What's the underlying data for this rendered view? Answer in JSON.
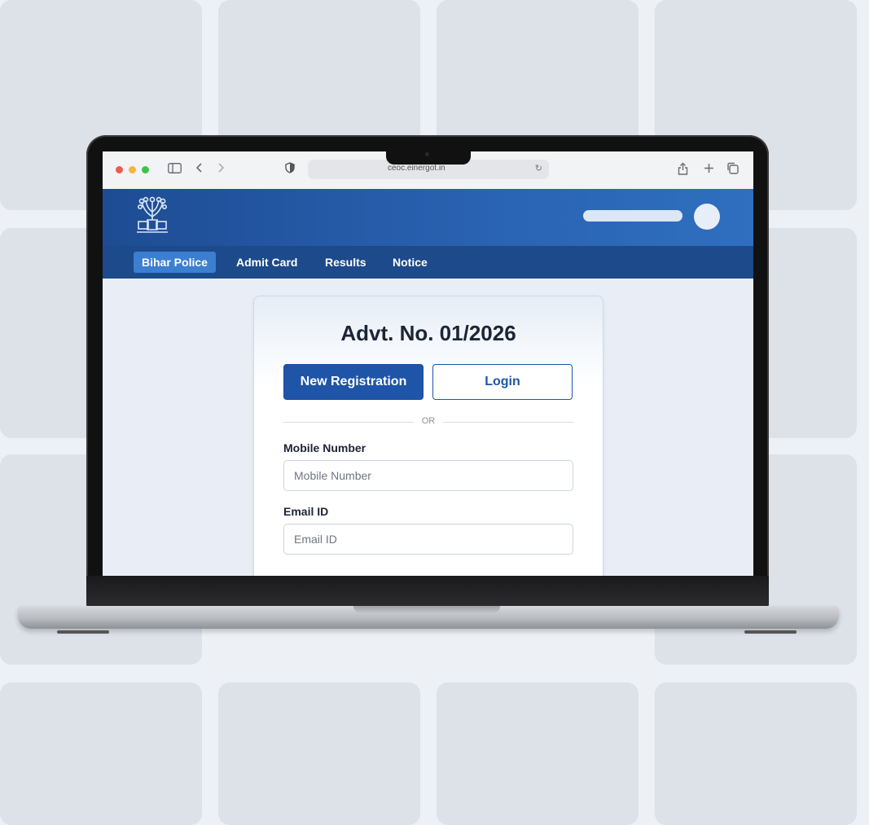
{
  "browser": {
    "url": "ceoc.einergot.in",
    "traffic_lights": [
      "#ee5a52",
      "#f5b43c",
      "#3ec24a"
    ],
    "icons": {
      "sidebar": "sidebar-icon",
      "back": "chevron-left-icon",
      "forward": "chevron-right-icon",
      "privacy": "shield-icon",
      "reload": "reload-icon",
      "share": "share-icon",
      "new_tab": "plus-icon",
      "tabs": "tabs-icon"
    }
  },
  "nav": {
    "items": [
      {
        "label": "Bihar Police",
        "active": true
      },
      {
        "label": "Admit Card",
        "active": false
      },
      {
        "label": "Results",
        "active": false
      },
      {
        "label": "Notice",
        "active": false
      }
    ]
  },
  "form": {
    "title": "Advt. No. 01/2026",
    "primary_button": "New Registration",
    "secondary_button": "Login",
    "separator": "OR",
    "mobile_label": "Mobile Number",
    "mobile_placeholder": "Mobile Number",
    "mobile_value": "",
    "email_label": "Email ID",
    "email_placeholder": "Email ID",
    "email_value": ""
  },
  "colors": {
    "header": "#2a63b3",
    "nav": "#1c4a8a",
    "nav_active": "#3b7fd0",
    "primary": "#1f55a8"
  }
}
